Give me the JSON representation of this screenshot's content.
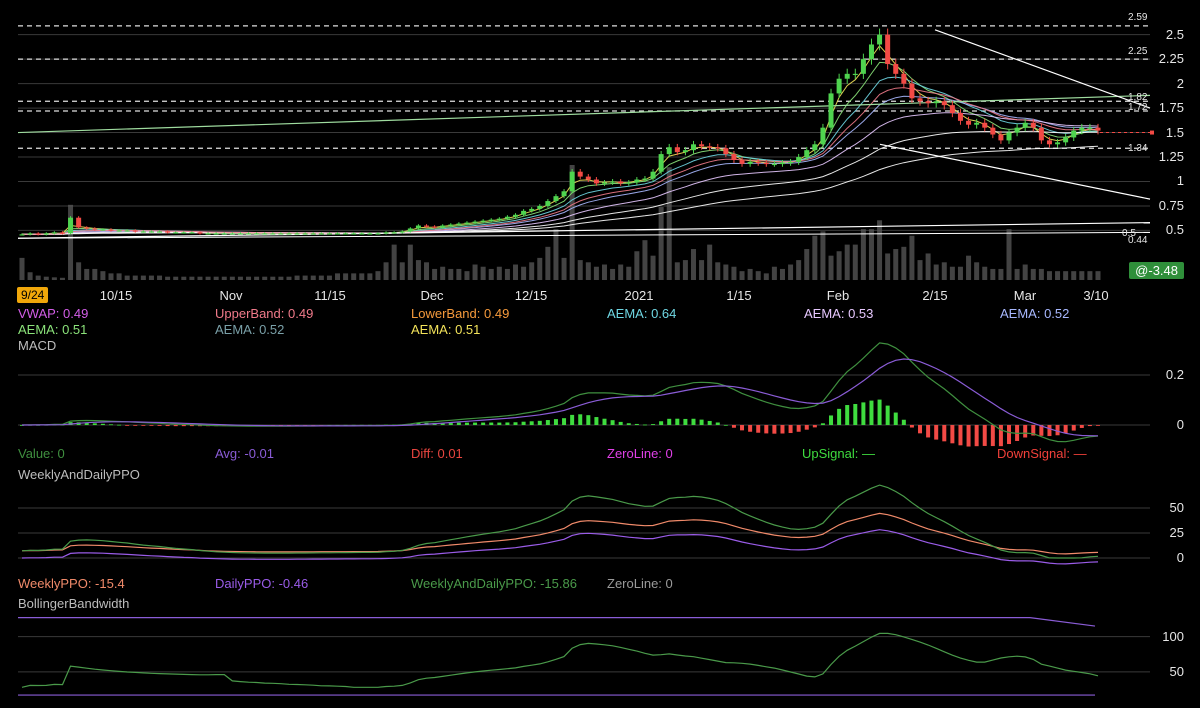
{
  "chart_data": [
    {
      "type": "line",
      "panel": "price",
      "ylim": [
        0.3,
        2.65
      ],
      "y_ticks": [
        "2.5",
        "2.25",
        "2",
        "1.75",
        "1.5",
        "1.25",
        "1",
        "0.75",
        "0.5"
      ],
      "price_labels": [
        "2.59",
        "2.25",
        "1.82",
        "1.72",
        "1.34",
        "0.5",
        "0.44"
      ],
      "x_ticks": [
        "10/15",
        "Nov",
        "11/15",
        "Dec",
        "12/15",
        "2021",
        "1/15",
        "Feb",
        "2/15",
        "Mar",
        "3/10"
      ],
      "current_date": "9/24",
      "price_badge": "@-3.48",
      "horizontal_levels": [
        2.59,
        2.25,
        1.82,
        1.72,
        1.34
      ],
      "candles": {
        "close": [
          0.46,
          0.47,
          0.46,
          0.47,
          0.48,
          0.47,
          0.63,
          0.53,
          0.52,
          0.51,
          0.51,
          0.5,
          0.5,
          0.5,
          0.49,
          0.49,
          0.49,
          0.49,
          0.48,
          0.48,
          0.48,
          0.48,
          0.47,
          0.47,
          0.47,
          0.47,
          0.47,
          0.47,
          0.47,
          0.47,
          0.47,
          0.47,
          0.47,
          0.47,
          0.47,
          0.47,
          0.47,
          0.47,
          0.47,
          0.47,
          0.47,
          0.47,
          0.47,
          0.47,
          0.47,
          0.48,
          0.48,
          0.49,
          0.52,
          0.55,
          0.54,
          0.53,
          0.55,
          0.56,
          0.57,
          0.58,
          0.59,
          0.6,
          0.61,
          0.62,
          0.64,
          0.66,
          0.7,
          0.72,
          0.75,
          0.8,
          0.85,
          0.9,
          1.1,
          1.05,
          1.02,
          0.98,
          0.99,
          1.0,
          0.98,
          0.99,
          1.02,
          1.03,
          1.1,
          1.28,
          1.35,
          1.3,
          1.32,
          1.38,
          1.36,
          1.35,
          1.34,
          1.28,
          1.22,
          1.18,
          1.2,
          1.19,
          1.18,
          1.18,
          1.19,
          1.2,
          1.25,
          1.32,
          1.38,
          1.55,
          1.9,
          2.05,
          2.1,
          2.1,
          2.25,
          2.4,
          2.5,
          2.2,
          2.1,
          2.0,
          1.85,
          1.82,
          1.8,
          1.82,
          1.78,
          1.7,
          1.62,
          1.58,
          1.6,
          1.55,
          1.48,
          1.42,
          1.5,
          1.55,
          1.6,
          1.55,
          1.42,
          1.38,
          1.4,
          1.45,
          1.52,
          1.55,
          1.55,
          1.52
        ],
        "volume": [
          1.0,
          0.35,
          0.2,
          0.15,
          0.12,
          0.1,
          3.4,
          0.8,
          0.5,
          0.5,
          0.4,
          0.3,
          0.3,
          0.2,
          0.2,
          0.2,
          0.2,
          0.2,
          0.15,
          0.15,
          0.15,
          0.15,
          0.15,
          0.15,
          0.15,
          0.15,
          0.15,
          0.15,
          0.15,
          0.15,
          0.15,
          0.15,
          0.15,
          0.15,
          0.2,
          0.2,
          0.2,
          0.2,
          0.2,
          0.3,
          0.3,
          0.3,
          0.3,
          0.3,
          0.4,
          0.8,
          1.6,
          0.8,
          1.6,
          0.9,
          0.8,
          0.5,
          0.6,
          0.5,
          0.5,
          0.4,
          0.7,
          0.6,
          0.5,
          0.6,
          0.5,
          0.7,
          0.6,
          0.8,
          1.0,
          1.5,
          2.3,
          1.0,
          5.2,
          0.9,
          0.8,
          0.6,
          0.7,
          0.5,
          0.7,
          0.6,
          1.3,
          1.8,
          1.1,
          3.3,
          5.1,
          0.8,
          0.9,
          1.4,
          0.9,
          1.6,
          0.8,
          0.7,
          0.6,
          0.4,
          0.5,
          0.4,
          0.3,
          0.6,
          0.5,
          0.7,
          0.9,
          1.4,
          2.0,
          2.2,
          1.1,
          1.3,
          1.6,
          1.6,
          2.3,
          2.3,
          2.7,
          1.2,
          1.4,
          1.5,
          2.0,
          0.9,
          1.2,
          0.7,
          0.8,
          0.6,
          0.6,
          1.1,
          0.8,
          0.6,
          0.5,
          0.5,
          2.3,
          0.5,
          0.7,
          0.5,
          0.5,
          0.4,
          0.4,
          0.4,
          0.4,
          0.4,
          0.4,
          0.4
        ]
      }
    },
    {
      "type": "line",
      "panel": "MACD",
      "title": "MACD",
      "y_ticks": [
        "0.2",
        "0"
      ],
      "ylim": [
        -0.06,
        0.28
      ]
    },
    {
      "type": "line",
      "panel": "WeeklyAndDailyPPO",
      "title": "WeeklyAndDailyPPO",
      "y_ticks": [
        "50",
        "25",
        "0"
      ],
      "ylim": [
        -12,
        70
      ]
    },
    {
      "type": "line",
      "panel": "BollingerBandwidth",
      "title": "BollingerBandwidth",
      "y_ticks": [
        "100",
        "50"
      ],
      "ylim": [
        10,
        135
      ]
    }
  ],
  "legend_price": [
    {
      "text": "VWAP: 0.49",
      "color": "#d35ee8"
    },
    {
      "text": "UpperBand: 0.49",
      "color": "#f07a8a"
    },
    {
      "text": "LowerBand: 0.49",
      "color": "#f59a3c"
    },
    {
      "text": "AEMA: 0.64",
      "color": "#6fd7e3"
    },
    {
      "text": "AEMA: 0.53",
      "color": "#e7c8ff"
    },
    {
      "text": "AEMA: 0.52",
      "color": "#a8b8ff"
    },
    {
      "text": "AEMA: 0.51",
      "color": "#8be37a"
    },
    {
      "text": "AEMA: 0.52",
      "color": "#7aa0a8"
    },
    {
      "text": "AEMA: 0.51",
      "color": "#f3e35a"
    }
  ],
  "legend_macd": [
    {
      "text": "Value: 0",
      "color": "#3f8f3f"
    },
    {
      "text": "Avg: -0.01",
      "color": "#8a5cd6"
    },
    {
      "text": "Diff: 0.01",
      "color": "#e8453f"
    },
    {
      "text": "ZeroLine: 0",
      "color": "#e040e8"
    },
    {
      "text": "UpSignal: —",
      "color": "#3fdc3f"
    },
    {
      "text": "DownSignal: —",
      "color": "#f0403a"
    }
  ],
  "legend_ppo": [
    {
      "text": "WeeklyPPO: -15.4",
      "color": "#f08a6a"
    },
    {
      "text": "DailyPPO: -0.46",
      "color": "#9a5ce8"
    },
    {
      "text": "WeeklyAndDailyPPO: -15.86",
      "color": "#4a9a4a"
    },
    {
      "text": "ZeroLine: 0",
      "color": "#9a9a9a"
    }
  ],
  "colors": {
    "up": "#4fd44f",
    "down": "#f24a45",
    "grid": "#3a3a3a",
    "text": "#e6e6e6"
  }
}
